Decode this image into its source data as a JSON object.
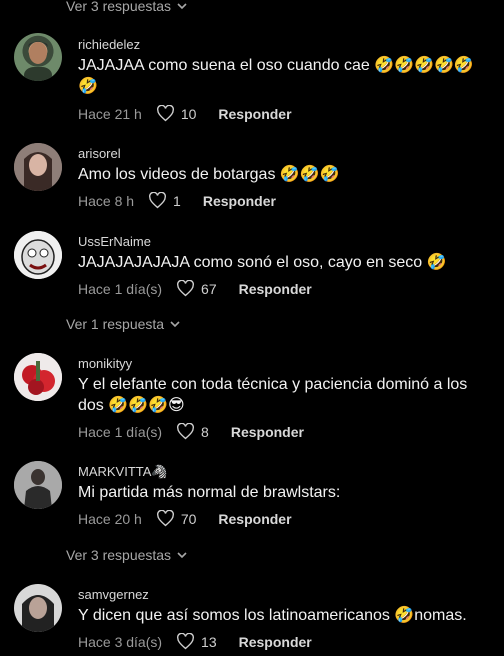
{
  "top_replies": {
    "label": "Ver 3 respuestas"
  },
  "comments": [
    {
      "username": "richiedelez",
      "text": "JAJAJAA como suena el oso cuando cae 🤣🤣🤣🤣🤣🤣",
      "time": "Hace 21 h",
      "likes": "10",
      "reply": "Responder"
    },
    {
      "username": "arisorel",
      "text": "Amo los videos de botargas 🤣🤣🤣",
      "time": "Hace 8 h",
      "likes": "1",
      "reply": "Responder"
    },
    {
      "username": "UssErNaime",
      "text": "JAJAJAJAJAJA como sonó el oso, cayo en seco 🤣",
      "time": "Hace 1 día(s)",
      "likes": "67",
      "reply": "Responder"
    },
    {
      "username": "monikityy",
      "text": "Y el elefante con toda técnica y paciencia dominó a los dos 🤣🤣🤣😎",
      "time": "Hace 1 día(s)",
      "likes": "8",
      "reply": "Responder"
    },
    {
      "username": "MARKVITTA🦓",
      "text": "Mi partida más normal de brawlstars:",
      "time": "Hace 20 h",
      "likes": "70",
      "reply": "Responder"
    },
    {
      "username": "samvgernez",
      "text": "Y dicen que así somos los latinoamericanos 🤣nomas.",
      "time": "Hace 3 día(s)",
      "likes": "13",
      "reply": "Responder"
    }
  ],
  "replies_after_usser": {
    "label": "Ver 1 respuesta"
  },
  "replies_after_mark": {
    "label": "Ver 3 respuestas"
  }
}
